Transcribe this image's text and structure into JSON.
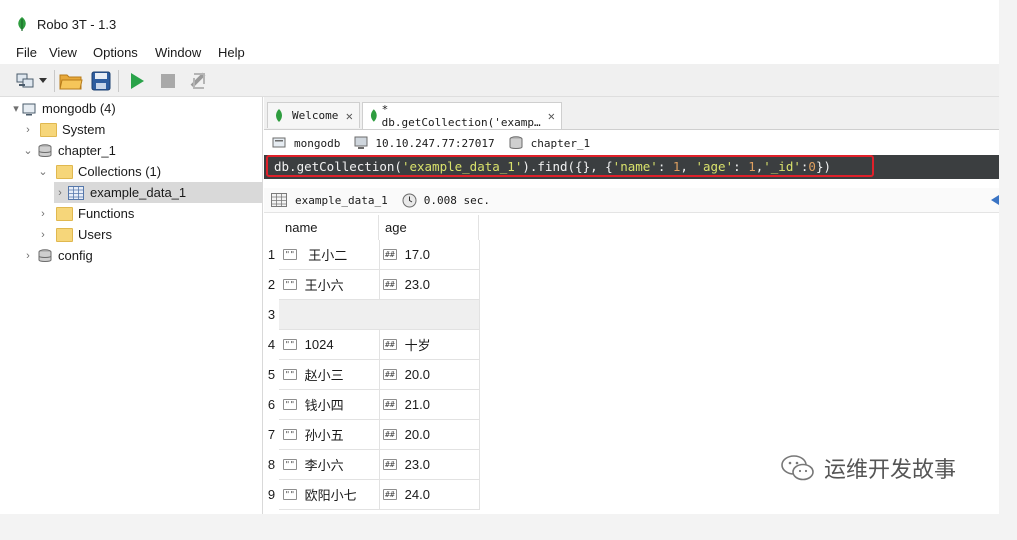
{
  "window": {
    "title": "Robo 3T - 1.3"
  },
  "menu": [
    "File",
    "View",
    "Options",
    "Window",
    "Help"
  ],
  "toolbar": {
    "icons": [
      "connect-icon",
      "dropdown-arrow-icon",
      "open-folder-icon",
      "save-icon",
      "execute-icon",
      "stop-icon",
      "move-icon"
    ]
  },
  "tree": {
    "connection": "mongodb (4)",
    "system": "System",
    "database": "chapter_1",
    "collections": "Collections (1)",
    "collection": "example_data_1",
    "functions": "Functions",
    "users": "Users",
    "config": "config"
  },
  "tabs": [
    {
      "label": "Welcome",
      "close": "✕"
    },
    {
      "label": "* db.getCollection('examp…",
      "close": "✕"
    }
  ],
  "info": {
    "server": "mongodb",
    "address": "10.10.247.77:27017",
    "database": "chapter_1"
  },
  "query": {
    "p1": "db.getCollection(",
    "p2": "'example_data_1'",
    "p3": ").find({}, {",
    "p4": "'name'",
    "p5": ": ",
    "p6": "1",
    "p7": ", ",
    "p8": "'age'",
    "p9": ": ",
    "p10": "1",
    "p11": ",",
    "p12": "'_id'",
    "p13": ":",
    "p14": "0",
    "p15": "})"
  },
  "result": {
    "collection": "example_data_1",
    "time": "0.008 sec."
  },
  "columns": [
    "name",
    "age"
  ],
  "type_icon": "\"\"",
  "num_icon": "##",
  "rows": [
    {
      "n": "1",
      "name": " 王小二",
      "age": "17.0"
    },
    {
      "n": "2",
      "name": "王小六",
      "age": "23.0"
    },
    {
      "n": "3",
      "name": "",
      "age": ""
    },
    {
      "n": "4",
      "name": "1024",
      "age": "十岁"
    },
    {
      "n": "5",
      "name": "赵小三",
      "age": "20.0"
    },
    {
      "n": "6",
      "name": "钱小四",
      "age": "21.0"
    },
    {
      "n": "7",
      "name": "孙小五",
      "age": "20.0"
    },
    {
      "n": "8",
      "name": "李小六",
      "age": "23.0"
    },
    {
      "n": "9",
      "name": "欧阳小七",
      "age": "24.0"
    }
  ],
  "watermark": "运维开发故事",
  "colors": {
    "query_bg": "#3b3e40",
    "highlight": "#e0202a",
    "string": "#d9e26b",
    "number": "#e0a060",
    "accent": "#2aa34a"
  }
}
